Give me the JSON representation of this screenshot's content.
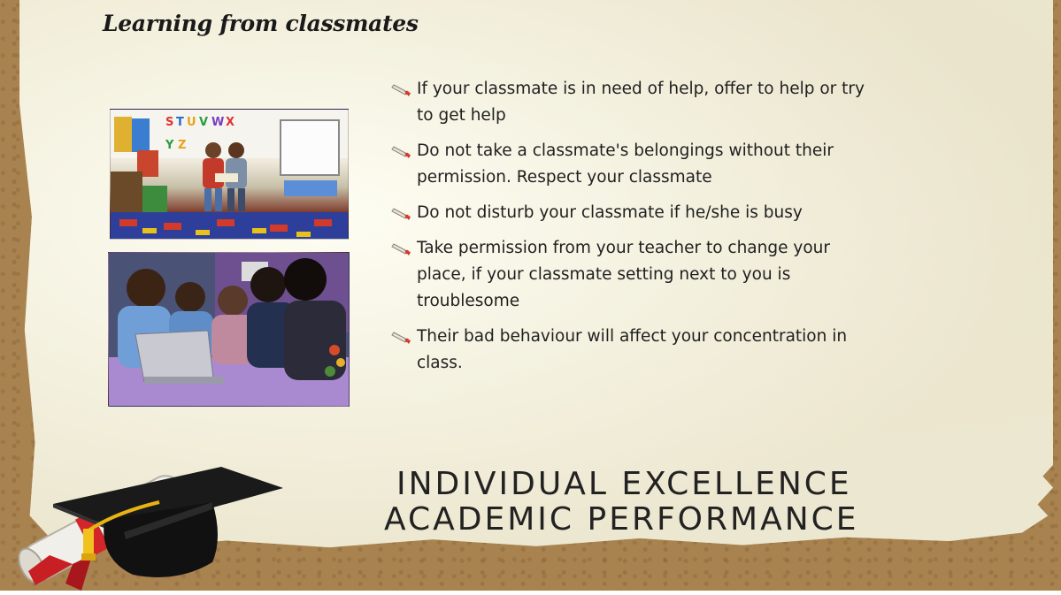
{
  "slide": {
    "title": "Learning from classmates",
    "bullets": [
      "If your classmate is in need of help, offer to help or try to get help",
      "Do not take a classmate's belongings without their permission. Respect your classmate",
      "Do not disturb your classmate if he/she is busy",
      "Take permission from your teacher to change your place, if your classmate setting next to you is troublesome",
      "Their bad behaviour will affect your concentration in class."
    ],
    "bullet_icon": "scroll-icon",
    "footer": {
      "line1": "INDIVIDUAL EXCELLENCE",
      "line2": "ACADEMIC PERFORMANCE"
    },
    "images": {
      "photo1": "classroom-children-photo",
      "photo2": "students-laptop-photo",
      "decor": "graduation-cap-diploma-icon"
    },
    "colors": {
      "paper": "#f3efdc",
      "border": "#a9834f",
      "text": "#1f1f1f"
    }
  }
}
